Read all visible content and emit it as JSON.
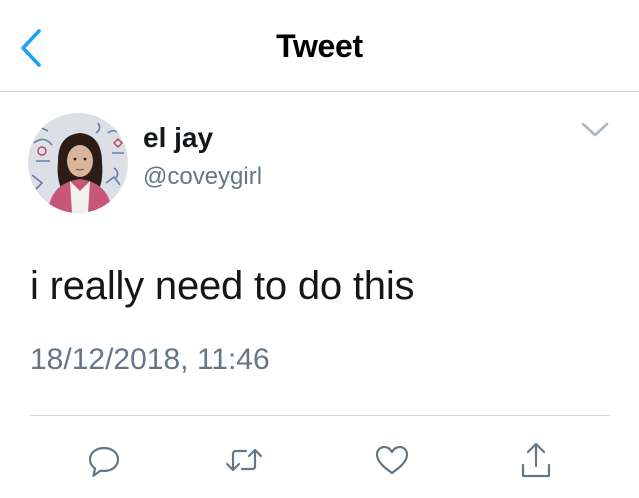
{
  "header": {
    "title": "Tweet",
    "back_icon": "chevron-left-icon",
    "accent_color": "#1da1f2"
  },
  "tweet": {
    "author_name": "el jay",
    "author_handle": "@coveygirl",
    "text": "i really need to do this",
    "timestamp": "18/12/2018, 11:46",
    "menu_icon": "chevron-down-icon"
  },
  "actions": [
    {
      "icon": "reply-icon"
    },
    {
      "icon": "retweet-icon"
    },
    {
      "icon": "like-icon"
    },
    {
      "icon": "share-icon"
    }
  ],
  "colors": {
    "text_primary": "#14171a",
    "text_secondary": "#657786",
    "divider": "#cfd4d8"
  }
}
